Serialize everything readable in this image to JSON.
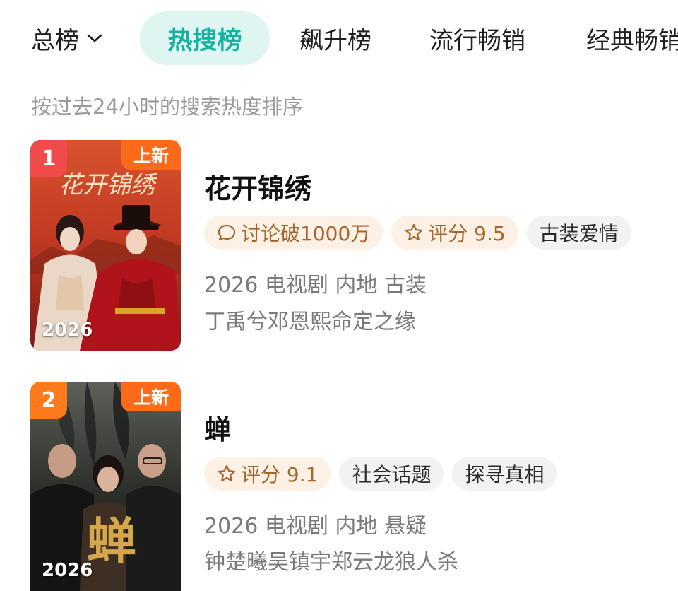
{
  "tabs": {
    "main_label": "总榜",
    "active_label": "热搜榜",
    "others": [
      "飙升榜",
      "流行畅销",
      "经典畅销"
    ]
  },
  "subtitle": "按过去24小时的搜索热度排序",
  "items": [
    {
      "rank": "1",
      "rank_color": "#f04a4a",
      "new_tag": "上新",
      "poster_year": "2026",
      "poster_title_art": "花开锦绣",
      "title": "花开锦绣",
      "chips": [
        {
          "icon": "comment-icon",
          "text": "讨论破1000万",
          "style": "warm"
        },
        {
          "icon": "star-icon",
          "text": "评分 9.5",
          "style": "warm"
        },
        {
          "icon": "",
          "text": "古装爱情",
          "style": "gray"
        }
      ],
      "meta": "2026 电视剧 内地 古装",
      "desc": "丁禹兮邓恩熙命定之缘"
    },
    {
      "rank": "2",
      "rank_color": "#ff7a1a",
      "new_tag": "上新",
      "poster_year": "2026",
      "poster_title_art": "蝉",
      "title": "蝉",
      "chips": [
        {
          "icon": "star-icon",
          "text": "评分 9.1",
          "style": "warm"
        },
        {
          "icon": "",
          "text": "社会话题",
          "style": "gray"
        },
        {
          "icon": "",
          "text": "探寻真相",
          "style": "gray"
        }
      ],
      "meta": "2026 电视剧 内地 悬疑",
      "desc": "钟楚曦吴镇宇郑云龙狼人杀"
    }
  ]
}
